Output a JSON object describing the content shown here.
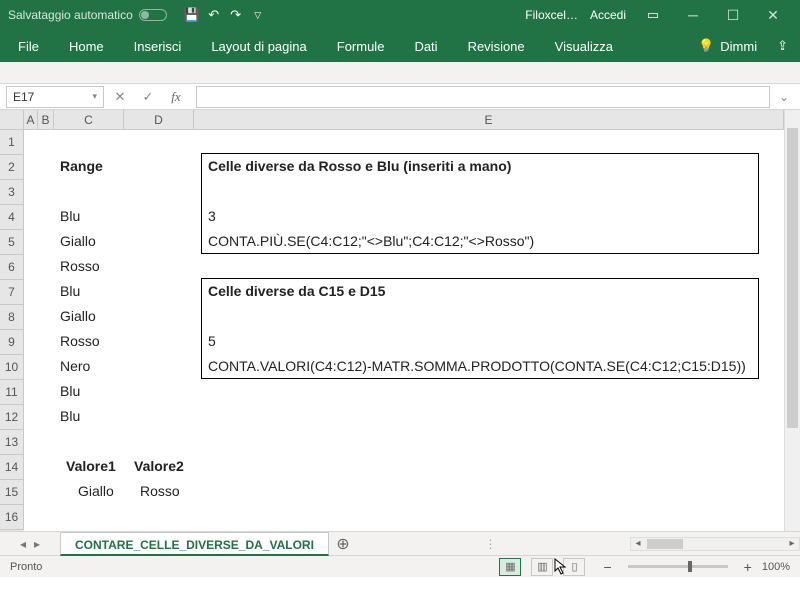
{
  "titlebar": {
    "autosave": "Salvataggio automatico",
    "doc": "Filoxcel…",
    "signin": "Accedi"
  },
  "ribbon": {
    "file": "File",
    "home": "Home",
    "insert": "Inserisci",
    "layout": "Layout di pagina",
    "formulas": "Formule",
    "data": "Dati",
    "review": "Revisione",
    "view": "Visualizza",
    "tell": "Dimmi"
  },
  "namebox": "E17",
  "cols": {
    "a": "A",
    "b": "B",
    "c": "C",
    "d": "D",
    "e": "E"
  },
  "rownums": [
    "1",
    "2",
    "3",
    "4",
    "5",
    "6",
    "7",
    "8",
    "9",
    "10",
    "11",
    "12",
    "13",
    "14",
    "15",
    "16"
  ],
  "c": {
    "c2": "Range",
    "c4": "Blu",
    "c5": "Giallo",
    "c6": "Rosso",
    "c7": "Blu",
    "c8": "Giallo",
    "c9": "Rosso",
    "c10": "Nero",
    "c11": "Blu",
    "c12": "Blu",
    "c14": "Valore1",
    "c15": "Giallo",
    "d14": "Valore2",
    "d15": "Rosso",
    "e2": "Celle diverse da Rosso e Blu (inseriti a mano)",
    "e4": "3",
    "e5": "CONTA.PIÙ.SE(C4:C12;\"<>Blu\";C4:C12;\"<>Rosso\")",
    "e7": "Celle diverse da C15 e D15",
    "e9": "5",
    "e10": "CONTA.VALORI(C4:C12)-MATR.SOMMA.PRODOTTO(CONTA.SE(C4:C12;C15:D15))"
  },
  "sheet": "CONTARE_CELLE_DIVERSE_DA_VALORI",
  "status": {
    "ready": "Pronto",
    "zoom": "100%"
  }
}
